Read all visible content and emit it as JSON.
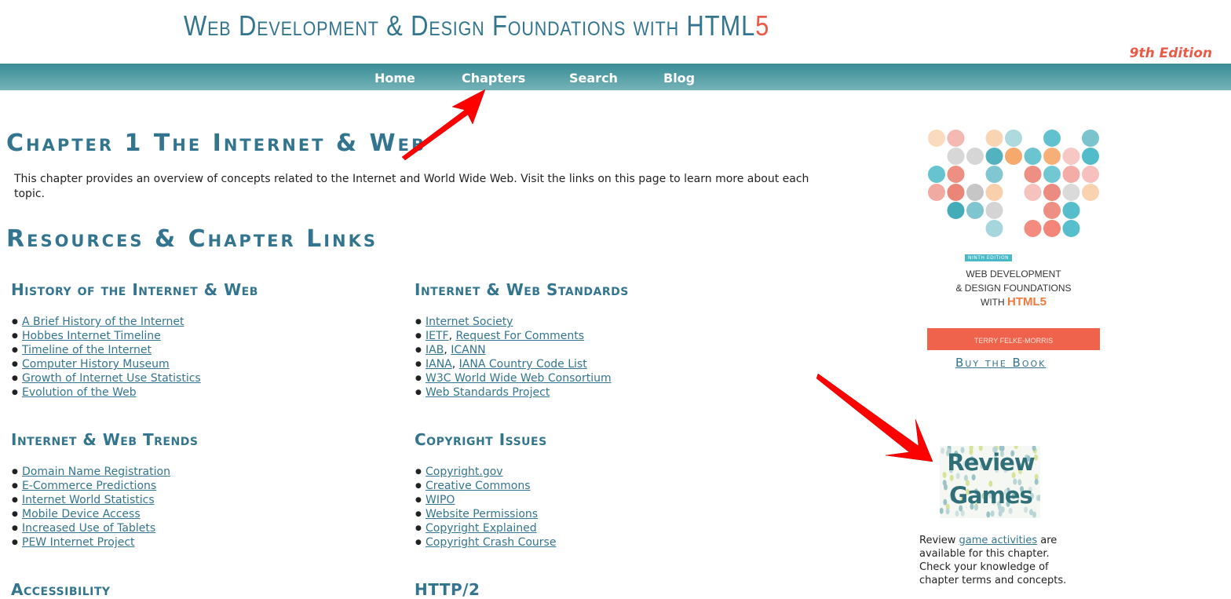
{
  "header": {
    "title_main": "Web Development & Design Foundations with HTML",
    "title_accent": "5",
    "edition": "9th Edition"
  },
  "nav": {
    "items": [
      {
        "label": "Home"
      },
      {
        "label": "Chapters"
      },
      {
        "label": "Search"
      },
      {
        "label": "Blog"
      }
    ]
  },
  "main": {
    "chapter_title": "Chapter 1 The Internet & Web",
    "intro": "This chapter provides an overview of concepts related to the Internet and World Wide Web. Visit the links on this page to learn more about each topic.",
    "resources_title": "Resources & Chapter Links",
    "sections": [
      {
        "title": "History of the Internet & Web",
        "links": [
          "A Brief History of the Internet",
          "Hobbes Internet Timeline",
          "Timeline of the Internet",
          "Computer History Museum",
          "Growth of Internet Use Statistics",
          "Evolution of the Web"
        ]
      },
      {
        "title": "Internet & Web Standards",
        "items": [
          [
            "Internet Society"
          ],
          [
            "IETF",
            "Request For Comments"
          ],
          [
            "IAB",
            "ICANN"
          ],
          [
            "IANA",
            "IANA Country Code List"
          ],
          [
            "W3C World Wide Web Consortium"
          ],
          [
            "Web Standards Project"
          ]
        ]
      },
      {
        "title": "Internet & Web Trends",
        "links": [
          "Domain Name Registration",
          "E-Commerce Predictions",
          "Internet World Statistics",
          "Mobile Device Access",
          "Increased Use of Tablets",
          "PEW Internet Project"
        ]
      },
      {
        "title": "Copyright Issues",
        "links": [
          "Copyright.gov",
          "Creative Commons",
          "WIPO",
          "Website Permissions",
          "Copyright Explained",
          "Copyright Crash Course"
        ]
      },
      {
        "title": "Accessibility"
      },
      {
        "title": "HTTP/2"
      }
    ]
  },
  "sidebar": {
    "cover_badge": "NINTH EDITION",
    "cover_line1": "WEB DEVELOPMENT",
    "cover_line2": "& DESIGN FOUNDATIONS",
    "cover_line3_prefix": "WITH ",
    "cover_line3_accent": "HTML5",
    "cover_author": "TERRY FELKE-MORRIS",
    "buy_book": "Buy the Book",
    "review_line1": "Review",
    "review_line2": "Games",
    "review_desc_prefix": "Review ",
    "review_link": "game activities",
    "review_desc_suffix": " are available for this chapter. Check your knowledge of chapter terms and concepts."
  },
  "colors": {
    "brand": "#33758f",
    "accent": "#ea5a47",
    "nav_top": "#3a8c95",
    "nav_bottom": "#74b3b7",
    "annotation_arrow": "#ff0000"
  }
}
